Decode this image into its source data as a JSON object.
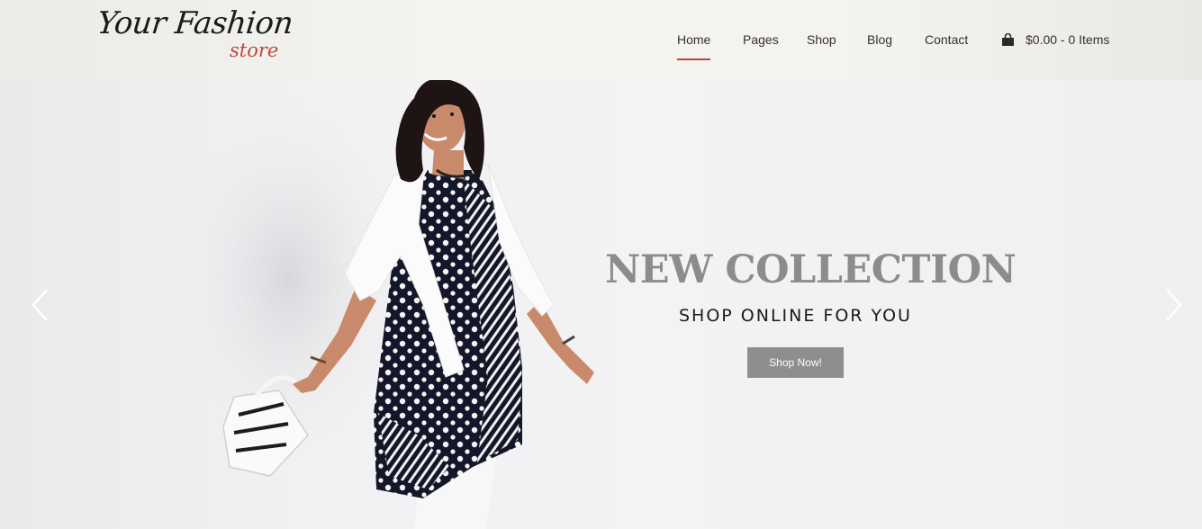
{
  "logo": {
    "main": "Your Fashion",
    "sub": "store"
  },
  "nav": {
    "items": [
      {
        "label": "Home"
      },
      {
        "label": "Pages"
      },
      {
        "label": "Shop"
      },
      {
        "label": "Blog"
      },
      {
        "label": "Contact"
      }
    ],
    "active": "Home"
  },
  "cart": {
    "icon": "shopping-bag-icon",
    "text": "$0.00 - 0 Items"
  },
  "hero": {
    "headline": "NEW COLLECTION",
    "subline": "SHOP ONLINE FOR YOU",
    "button": "Shop Now!",
    "prev_icon": "chevron-left-icon",
    "next_icon": "chevron-right-icon"
  },
  "colors": {
    "accent": "#c2453d",
    "button_bg": "#8e8e8e",
    "headline": "#8c8c8c"
  }
}
